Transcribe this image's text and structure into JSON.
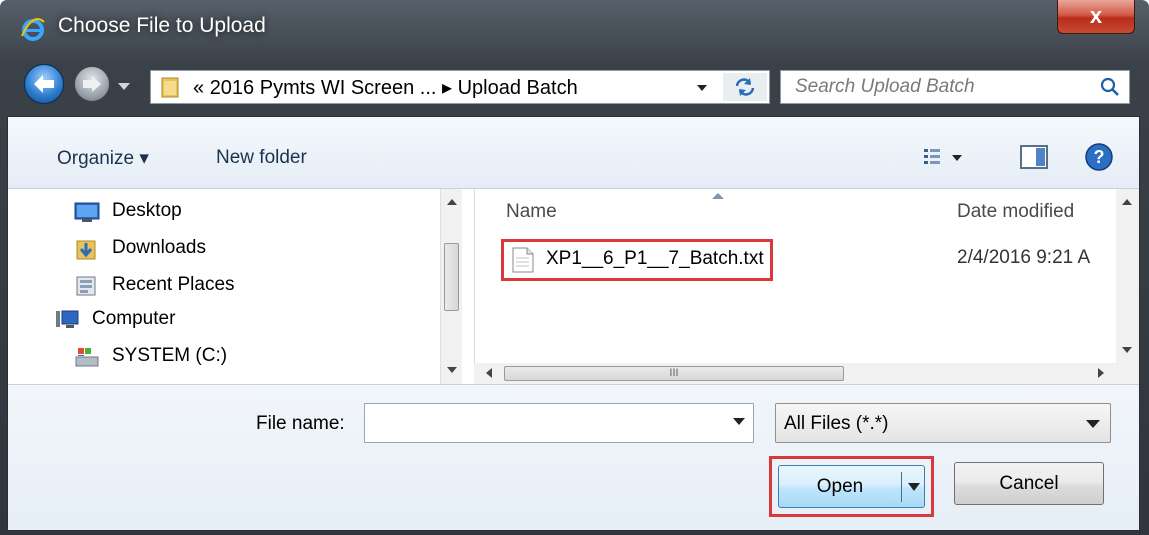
{
  "window": {
    "title": "Choose File to Upload",
    "close_glyph": "x"
  },
  "navigation": {
    "address_chevron": "«",
    "breadcrumb_parent": "2016 Pymts WI Screen ...",
    "breadcrumb_separator": "▸",
    "breadcrumb_current": "Upload Batch",
    "search_placeholder": "Search Upload Batch"
  },
  "toolbar": {
    "organize_label": "Organize ▾",
    "new_folder_label": "New folder",
    "views_icon": "views-icon",
    "preview_icon": "preview-pane-icon",
    "help_icon": "help-icon"
  },
  "nav_pane": {
    "items": [
      {
        "label": "Desktop",
        "icon": "desktop-icon"
      },
      {
        "label": "Downloads",
        "icon": "downloads-icon"
      },
      {
        "label": "Recent Places",
        "icon": "recent-places-icon"
      },
      {
        "label": "Computer",
        "icon": "computer-icon"
      },
      {
        "label": "SYSTEM (C:)",
        "icon": "drive-icon"
      }
    ]
  },
  "file_list": {
    "columns": [
      "Name",
      "Date modified"
    ],
    "rows": [
      {
        "name": "XP1__6_P1__7_Batch.txt",
        "date_modified": "2/4/2016 9:21 A",
        "icon": "text-file-icon"
      }
    ],
    "hscroll_grip": "III"
  },
  "footer": {
    "file_name_label": "File name:",
    "file_name_value": "",
    "file_type": "All Files (*.*)",
    "open_label": "Open",
    "cancel_label": "Cancel"
  },
  "colors": {
    "highlight": "#d9393b",
    "frame": "#2f363d"
  }
}
